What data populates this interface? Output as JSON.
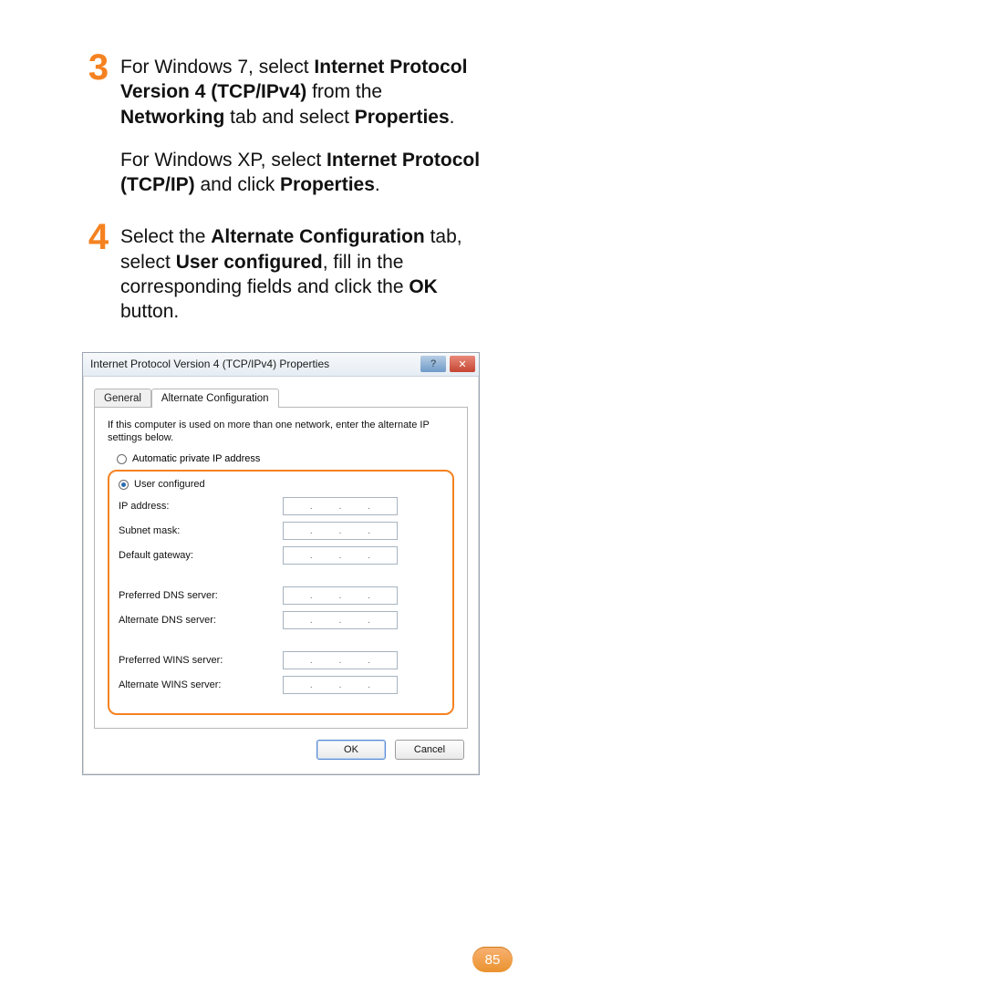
{
  "steps": {
    "step3": {
      "num": "3",
      "line1a": "For Windows 7, select ",
      "line1b": "Internet Protocol Version 4 (TCP/IPv4)",
      "line1c": " from the ",
      "line1d": "Networking",
      "line1e": " tab and select ",
      "line1f": "Properties",
      "line1g": ".",
      "xp_a": "For Windows XP, select ",
      "xp_b": "Internet Protocol (TCP/IP)",
      "xp_c": " and click ",
      "xp_d": "Properties",
      "xp_e": "."
    },
    "step4": {
      "num": "4",
      "a": "Select the ",
      "b": "Alternate Configuration",
      "c": " tab, select ",
      "d": "User configured",
      "e": ", fill in the corresponding fields and click the ",
      "f": "OK",
      "g": " button."
    }
  },
  "dialog": {
    "title": "Internet Protocol Version 4 (TCP/IPv4) Properties",
    "help_symbol": "?",
    "close_symbol": "✕",
    "tabs": {
      "general": "General",
      "alt": "Alternate Configuration"
    },
    "note": "If this computer is used on more than one network, enter the alternate IP settings below.",
    "radio_auto": "Automatic private IP address",
    "radio_user": "User configured",
    "fields": {
      "ip": "IP address:",
      "subnet": "Subnet mask:",
      "gateway": "Default gateway:",
      "pdns": "Preferred DNS server:",
      "adns": "Alternate DNS server:",
      "pwins": "Preferred WINS server:",
      "awins": "Alternate WINS server:"
    },
    "ok": "OK",
    "cancel": "Cancel"
  },
  "page_number": "85"
}
